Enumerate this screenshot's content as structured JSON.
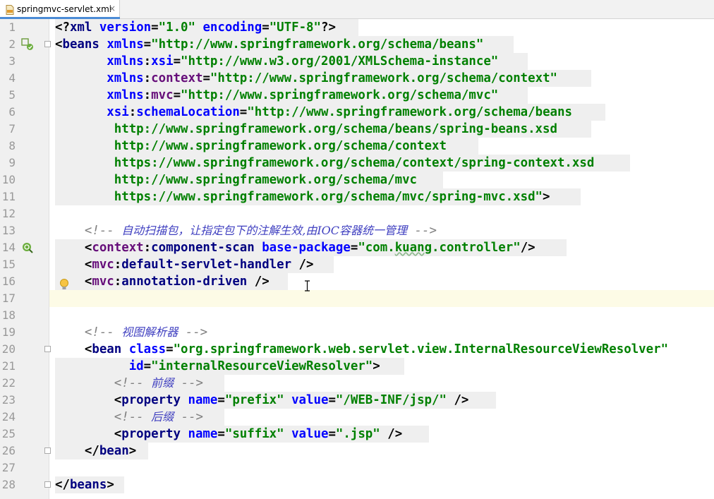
{
  "tab": {
    "file_name": "springmvc-servlet.xml",
    "close": "×"
  },
  "editor": {
    "line_numbers": [
      "1",
      "2",
      "3",
      "4",
      "5",
      "6",
      "7",
      "8",
      "9",
      "10",
      "11",
      "12",
      "13",
      "14",
      "15",
      "16",
      "17",
      "18",
      "19",
      "20",
      "21",
      "22",
      "23",
      "24",
      "25",
      "26",
      "27",
      "28"
    ],
    "lines": [
      [
        [
          "<?",
          "pun"
        ],
        [
          "xml ",
          "tag"
        ],
        [
          "version",
          "attr"
        ],
        [
          "=",
          "pun"
        ],
        [
          "\"1.0\" ",
          "val"
        ],
        [
          "encoding",
          "attr"
        ],
        [
          "=",
          "pun"
        ],
        [
          "\"UTF-8\"",
          "val"
        ],
        [
          "?>",
          "pun"
        ]
      ],
      [
        [
          "<",
          "pun"
        ],
        [
          "beans ",
          "tag"
        ],
        [
          "xmlns",
          "attr"
        ],
        [
          "=",
          "pun"
        ],
        [
          "\"http://www.springframework.org/schema/beans\"",
          "val"
        ]
      ],
      [
        [
          "       ",
          "pun"
        ],
        [
          "xmlns",
          "attr"
        ],
        [
          ":",
          "pun"
        ],
        [
          "xsi",
          "attr"
        ],
        [
          "=",
          "pun"
        ],
        [
          "\"http://www.w3.org/2001/XMLSchema-instance\"",
          "val"
        ]
      ],
      [
        [
          "       ",
          "pun"
        ],
        [
          "xmlns",
          "attr"
        ],
        [
          ":",
          "pun"
        ],
        [
          "context",
          "ns"
        ],
        [
          "=",
          "pun"
        ],
        [
          "\"http://www.springframework.org/schema/context\"",
          "val"
        ]
      ],
      [
        [
          "       ",
          "pun"
        ],
        [
          "xmlns",
          "attr"
        ],
        [
          ":",
          "pun"
        ],
        [
          "mvc",
          "ns"
        ],
        [
          "=",
          "pun"
        ],
        [
          "\"http://www.springframework.org/schema/mvc\"",
          "val"
        ]
      ],
      [
        [
          "       ",
          "pun"
        ],
        [
          "xsi",
          "attr"
        ],
        [
          ":",
          "pun"
        ],
        [
          "schemaLocation",
          "attr"
        ],
        [
          "=",
          "pun"
        ],
        [
          "\"http://www.springframework.org/schema/beans",
          "val"
        ]
      ],
      [
        [
          "        http://www.springframework.org/schema/beans/spring-beans.xsd",
          "val"
        ]
      ],
      [
        [
          "        http://www.springframework.org/schema/context",
          "val"
        ]
      ],
      [
        [
          "        https://www.springframework.org/schema/context/spring-context.xsd",
          "val"
        ]
      ],
      [
        [
          "        http://www.springframework.org/schema/mvc",
          "val"
        ]
      ],
      [
        [
          "        https://www.springframework.org/schema/mvc/spring-mvc.xsd\"",
          "val"
        ],
        [
          ">",
          "pun"
        ]
      ],
      [],
      [
        [
          "    ",
          "pun"
        ],
        [
          "<!-- ",
          "com"
        ],
        [
          "自动扫描包，让指定包下的注解生效,由IOC容器统一管理",
          "com-zh"
        ],
        [
          " -->",
          "com"
        ]
      ],
      [
        [
          "    <",
          "pun"
        ],
        [
          "context",
          "ns"
        ],
        [
          ":",
          "pun"
        ],
        [
          "component-scan ",
          "tag"
        ],
        [
          "base-package",
          "attr"
        ],
        [
          "=",
          "pun"
        ],
        [
          "\"com.",
          "val"
        ],
        [
          "kuang",
          "val squiggle"
        ],
        [
          ".controller\"",
          "val"
        ],
        [
          "/>",
          "pun"
        ]
      ],
      [
        [
          "    <",
          "pun"
        ],
        [
          "mvc",
          "ns"
        ],
        [
          ":",
          "pun"
        ],
        [
          "default-servlet-handler ",
          "tag"
        ],
        [
          "/>",
          "pun"
        ]
      ],
      [
        [
          "    <",
          "pun"
        ],
        [
          "mvc",
          "ns"
        ],
        [
          ":",
          "pun"
        ],
        [
          "annotation-driven ",
          "tag"
        ],
        [
          "/>",
          "pun"
        ]
      ],
      [],
      [],
      [
        [
          "    ",
          "pun"
        ],
        [
          "<!-- ",
          "com"
        ],
        [
          "视图解析器",
          "com-zh"
        ],
        [
          " -->",
          "com"
        ]
      ],
      [
        [
          "    <",
          "pun"
        ],
        [
          "bean ",
          "tag"
        ],
        [
          "class",
          "attr"
        ],
        [
          "=",
          "pun"
        ],
        [
          "\"org.springframework.web.servlet.view.InternalResourceViewResolver\"",
          "val"
        ]
      ],
      [
        [
          "          ",
          "pun"
        ],
        [
          "id",
          "attr"
        ],
        [
          "=",
          "pun"
        ],
        [
          "\"internalResourceViewResolver\"",
          "val"
        ],
        [
          ">",
          "pun"
        ]
      ],
      [
        [
          "        ",
          "pun"
        ],
        [
          "<!-- ",
          "com"
        ],
        [
          "前缀",
          "com-zh"
        ],
        [
          " -->",
          "com"
        ]
      ],
      [
        [
          "        <",
          "pun"
        ],
        [
          "property ",
          "tag"
        ],
        [
          "name",
          "attr"
        ],
        [
          "=",
          "pun"
        ],
        [
          "\"prefix\" ",
          "val"
        ],
        [
          "value",
          "attr"
        ],
        [
          "=",
          "pun"
        ],
        [
          "\"/WEB-INF/jsp/\" ",
          "val"
        ],
        [
          "/>",
          "pun"
        ]
      ],
      [
        [
          "        ",
          "pun"
        ],
        [
          "<!-- ",
          "com"
        ],
        [
          "后缀",
          "com-zh"
        ],
        [
          " -->",
          "com"
        ]
      ],
      [
        [
          "        <",
          "pun"
        ],
        [
          "property ",
          "tag"
        ],
        [
          "name",
          "attr"
        ],
        [
          "=",
          "pun"
        ],
        [
          "\"suffix\" ",
          "val"
        ],
        [
          "value",
          "attr"
        ],
        [
          "=",
          "pun"
        ],
        [
          "\".jsp\" ",
          "val"
        ],
        [
          "/>",
          "pun"
        ]
      ],
      [
        [
          "    </",
          "pun"
        ],
        [
          "bean",
          "tag"
        ],
        [
          ">",
          "pun"
        ]
      ],
      [],
      [
        [
          "</",
          "pun"
        ],
        [
          "beans",
          "tag"
        ],
        [
          ">",
          "pun"
        ]
      ]
    ]
  },
  "colors": {
    "tag": "#000080",
    "attribute": "#0000ff",
    "namespace": "#660e7a",
    "value": "#008000",
    "comment": "#808080",
    "selection_bg": "#efefef",
    "caret_line": "#fdfbe6"
  },
  "icons": [
    "xml-file-icon",
    "spring-bean-icon",
    "spring-component-scan-icon",
    "lightbulb-icon",
    "fold-marker-icon",
    "text-cursor-icon"
  ]
}
